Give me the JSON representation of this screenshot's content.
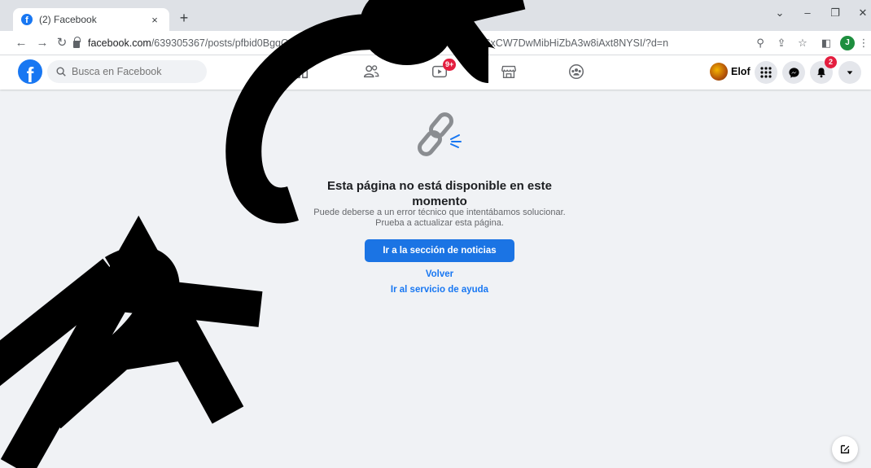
{
  "browser": {
    "tab_title": "(2) Facebook",
    "tab_close": "×",
    "new_tab": "+",
    "url_host": "facebook.com",
    "url_path": "/639305367/posts/pfbid0BgqQGvho7h12KNLpAyi7PbdQjt7YngcSLn7MZp6xCW7DwMibHiZbA3w8iAxt8NYSI/?d=n",
    "profile_initial": "J",
    "icons": [
      "back-arrow-icon",
      "forward-arrow-icon",
      "reload-icon",
      "lock-icon",
      "zoom-icon",
      "share-icon",
      "star-icon",
      "sidepanel-icon",
      "menu-dots-icon"
    ]
  },
  "facebook": {
    "search_placeholder": "Busca en Facebook",
    "watch_badge": "9+",
    "user_name": "Elof",
    "notifications_badge": "2",
    "brand_color": "#1877f2"
  },
  "error": {
    "heading": "Esta página no está disponible en este momento",
    "line1": "Puede deberse a un error técnico que intentábamos solucionar.",
    "line2": "Prueba a actualizar esta página.",
    "primary_button": "Ir a la sección de noticias",
    "back_link": "Volver",
    "help_link": "Ir al servicio de ayuda"
  }
}
